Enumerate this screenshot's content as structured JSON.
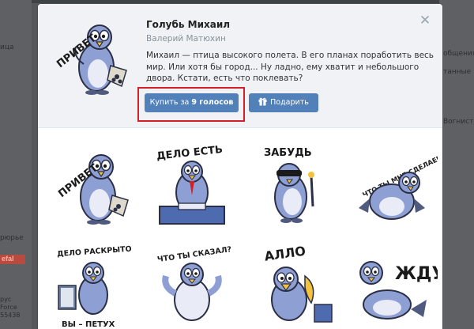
{
  "background": {
    "left_texts": [
      "ица",
      "рюрье"
    ],
    "right_texts": [
      "общения",
      "танные",
      "Вогнист"
    ],
    "logo_text": "efal",
    "left_small": [
      "рус",
      "Force",
      "55438"
    ]
  },
  "pack": {
    "title": "Голубь Михаил",
    "author": "Валерий Матюхин",
    "description": "Михаил — птица высокого полета. В его планах поработить весь мир. Или хотя бы город... Ну ладно, ему хватит и небольшого двора. Кстати, есть что поклевать?",
    "buy_label_prefix": "Купить за ",
    "buy_label_bold": "9 голосов",
    "gift_label": "Подарить",
    "close_icon": "close-icon",
    "gift_icon": "gift-icon"
  },
  "stickers": [
    {
      "caption": "ПРИВЕТ"
    },
    {
      "caption": "ДЕЛО ЕСТЬ"
    },
    {
      "caption": "ЗАБУДЬ"
    },
    {
      "caption": "ЧТО ТЫ МНЕ СДЕЛАЕШЬ?"
    },
    {
      "caption": "ДЕЛО РАСКРЫТО",
      "caption2": "ВЫ – ПЕТУХ"
    },
    {
      "caption": "ЧТО ТЫ СКАЗАЛ?"
    },
    {
      "caption": "АЛЛО"
    },
    {
      "caption": "ЖДУ"
    }
  ],
  "colors": {
    "accent": "#5181b8",
    "highlight": "#d31f26",
    "pigeon": "#8e9fd4",
    "pigeon_dark": "#4f5a7e"
  }
}
